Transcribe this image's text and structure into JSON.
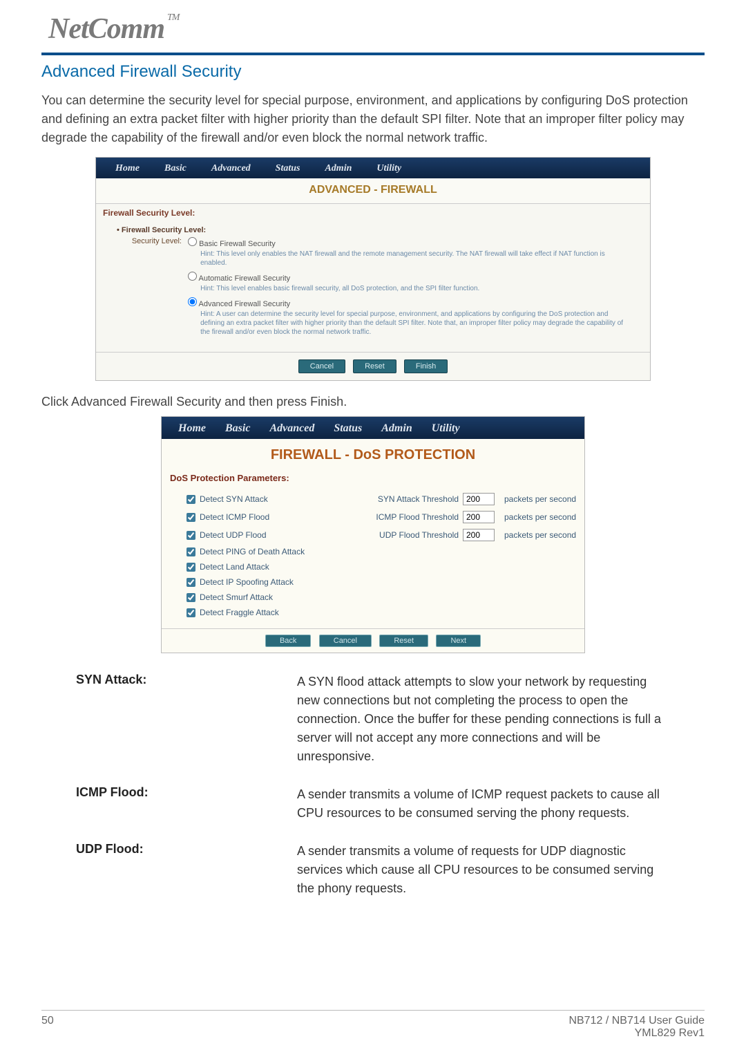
{
  "brand": {
    "name": "NetComm",
    "tm": "TM"
  },
  "section_title": "Advanced Firewall Security",
  "intro": "You can determine the security level for special purpose, environment, and applications by configuring DoS protection and defining an extra packet filter with higher priority than the default SPI filter. Note that an improper filter policy may degrade the capability of the firewall and/or even block the normal network traffic.",
  "nav_tabs": [
    "Home",
    "Basic",
    "Advanced",
    "Status",
    "Admin",
    "Utility"
  ],
  "shot1": {
    "page_head": "ADVANCED - FIREWALL",
    "panel_title": "Firewall Security Level:",
    "row_title": "Firewall Security Level:",
    "sec_label": "Security Level:",
    "opt1": {
      "label": "Basic Firewall Security",
      "hint": "Hint: This level only enables the NAT firewall and the remote management security. The NAT firewall will take effect if NAT function is enabled."
    },
    "opt2": {
      "label": "Automatic Firewall Security",
      "hint": "Hint: This level enables basic firewall security, all DoS protection, and the SPI filter function."
    },
    "opt3": {
      "label": "Advanced Firewall Security",
      "hint": "Hint: A user can determine the security level for special purpose, environment, and applications by configuring the DoS protection and defining an extra packet filter with higher priority than the default SPI filter. Note that, an improper filter policy may degrade the capability of the firewall and/or even block the normal network traffic."
    },
    "buttons": {
      "cancel": "Cancel",
      "reset": "Reset",
      "finish": "Finish"
    }
  },
  "caption": "Click Advanced Firewall Security and then press Finish.",
  "shot2": {
    "page_head": "FIREWALL - DoS PROTECTION",
    "panel_title": "DoS Protection Parameters:",
    "rows": [
      {
        "cb": "Detect SYN Attack",
        "th": "SYN Attack Threshold",
        "val": "200",
        "unit": "packets per second"
      },
      {
        "cb": "Detect ICMP Flood",
        "th": "ICMP Flood Threshold",
        "val": "200",
        "unit": "packets per second"
      },
      {
        "cb": "Detect UDP Flood",
        "th": "UDP Flood Threshold",
        "val": "200",
        "unit": "packets per second"
      }
    ],
    "simple": [
      "Detect PING of Death Attack",
      "Detect Land Attack",
      "Detect IP Spoofing Attack",
      "Detect Smurf Attack",
      "Detect Fraggle Attack"
    ],
    "buttons": {
      "back": "Back",
      "cancel": "Cancel",
      "reset": "Reset",
      "next": "Next"
    }
  },
  "defs": {
    "syn": {
      "term": "SYN Attack:",
      "desc": "A SYN flood attack attempts to slow your network by requesting new connections but not completing the process to open the connection. Once the buffer for these pending connections is full a server will not accept any more connections and will be unresponsive."
    },
    "icmp": {
      "term": "ICMP Flood:",
      "desc": "A sender transmits a volume of ICMP request packets to cause all CPU resources to be consumed serving the phony requests."
    },
    "udp": {
      "term": "UDP Flood:",
      "desc": "A sender transmits a volume of requests for UDP diagnostic services which cause all CPU resources to be consumed serving the phony requests."
    }
  },
  "footer": {
    "page": "50",
    "guide": "NB712 / NB714 User Guide",
    "rev": "YML829 Rev1"
  }
}
